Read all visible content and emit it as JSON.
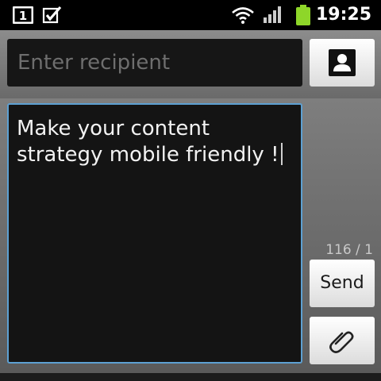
{
  "status_bar": {
    "notification_count": "1",
    "time": "19:25",
    "icons": [
      "notification-one-icon",
      "task-check-icon",
      "wifi-icon",
      "signal-icon",
      "battery-icon"
    ]
  },
  "recipient": {
    "placeholder": "Enter recipient",
    "contact_button_icon": "contact-person-icon"
  },
  "compose": {
    "message": "Make your content strategy mobile friendly !",
    "char_count": "116 / 1",
    "send_label": "Send",
    "attach_icon": "paperclip-icon"
  },
  "colors": {
    "focus_border": "#5da0d2",
    "battery": "#8ed629",
    "field_background": "#141414"
  }
}
